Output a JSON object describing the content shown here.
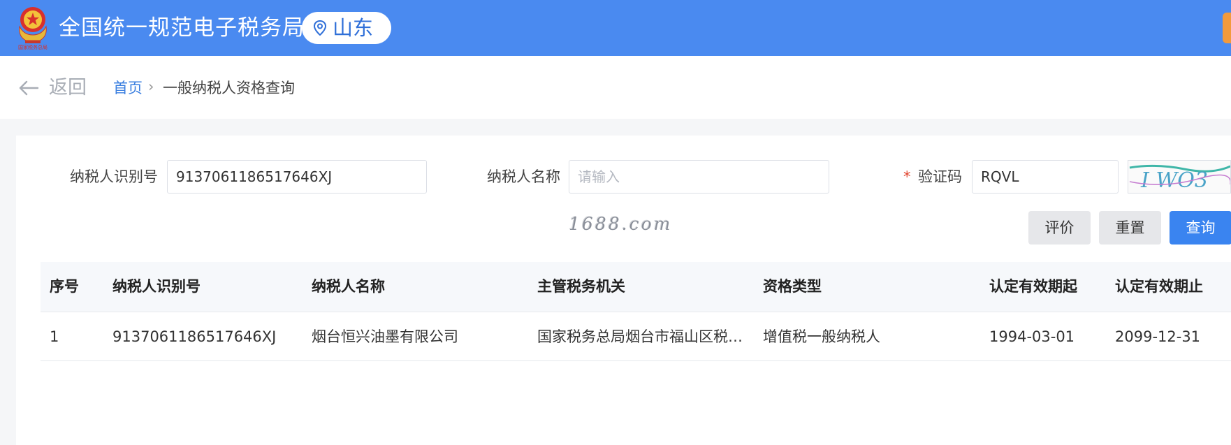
{
  "header": {
    "site_title": "全国统一规范电子税务局",
    "region": "山东",
    "emblem_text": "国家税务总局"
  },
  "breadcrumb": {
    "back_label": "返回",
    "home": "首页",
    "separator": "›",
    "current": "一般纳税人资格查询"
  },
  "form": {
    "taxpayer_id_label": "纳税人识别号",
    "taxpayer_id_value": "9137061186517646XJ",
    "taxpayer_name_label": "纳税人名称",
    "taxpayer_name_placeholder": "请输入",
    "captcha_required_mark": "*",
    "captcha_label": "验证码",
    "captcha_value": "RQVL",
    "captcha_image_text": "I WO3"
  },
  "watermark": "1688.com",
  "buttons": {
    "evaluate": "评价",
    "reset": "重置",
    "query": "查询"
  },
  "table": {
    "headers": [
      "序号",
      "纳税人识别号",
      "纳税人名称",
      "主管税务机关",
      "资格类型",
      "认定有效期起",
      "认定有效期止"
    ],
    "rows": [
      [
        "1",
        "9137061186517646XJ",
        "烟台恒兴油墨有限公司",
        "国家税务总局烟台市福山区税…",
        "增值税一般纳税人",
        "1994-03-01",
        "2099-12-31"
      ]
    ]
  },
  "colors": {
    "header_blue": "#4a8af0",
    "primary_button": "#3a84f0",
    "link_blue": "#3b7fe0",
    "required_red": "#e2452f",
    "orange_accent": "#f29a3c"
  }
}
